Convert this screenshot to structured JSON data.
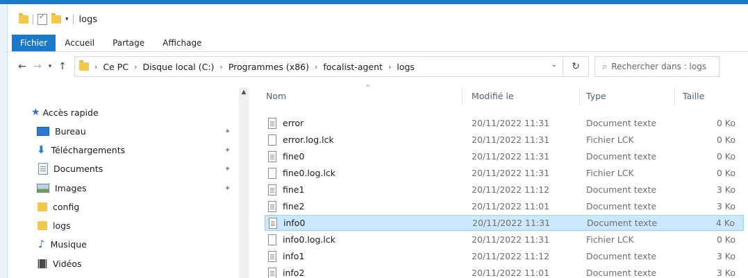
{
  "window": {
    "title": "logs"
  },
  "ribbon": {
    "tabs": [
      "Fichier",
      "Accueil",
      "Partage",
      "Affichage"
    ]
  },
  "address": {
    "crumbs": [
      "Ce PC",
      "Disque local (C:)",
      "Programmes (x86)",
      "focalist-agent",
      "logs"
    ]
  },
  "search": {
    "placeholder": "Rechercher dans : logs"
  },
  "nav": {
    "items": [
      {
        "label": "Accès rapide",
        "icon": "star-icon"
      },
      {
        "label": "Bureau",
        "icon": "desktop-icon",
        "pinned": true
      },
      {
        "label": "Téléchargements",
        "icon": "download-icon",
        "pinned": true
      },
      {
        "label": "Documents",
        "icon": "documents-icon",
        "pinned": true
      },
      {
        "label": "Images",
        "icon": "pictures-icon",
        "pinned": true
      },
      {
        "label": "config",
        "icon": "folder-icon"
      },
      {
        "label": "logs",
        "icon": "folder-icon"
      },
      {
        "label": "Musique",
        "icon": "music-icon"
      },
      {
        "label": "Vidéos",
        "icon": "videos-icon"
      }
    ]
  },
  "columns": {
    "name": "Nom",
    "modified": "Modifié le",
    "type": "Type",
    "size": "Taille"
  },
  "files": [
    {
      "name": "error",
      "modified": "20/11/2022 11:31",
      "type": "Document texte",
      "size": "0 Ko",
      "icon": "text-file-icon"
    },
    {
      "name": "error.log.lck",
      "modified": "20/11/2022 11:31",
      "type": "Fichier LCK",
      "size": "0 Ko",
      "icon": "file-icon"
    },
    {
      "name": "fine0",
      "modified": "20/11/2022 11:31",
      "type": "Document texte",
      "size": "0 Ko",
      "icon": "text-file-icon"
    },
    {
      "name": "fine0.log.lck",
      "modified": "20/11/2022 11:31",
      "type": "Fichier LCK",
      "size": "0 Ko",
      "icon": "file-icon"
    },
    {
      "name": "fine1",
      "modified": "20/11/2022 11:12",
      "type": "Document texte",
      "size": "3 Ko",
      "icon": "text-file-icon"
    },
    {
      "name": "fine2",
      "modified": "20/11/2022 11:01",
      "type": "Document texte",
      "size": "3 Ko",
      "icon": "text-file-icon"
    },
    {
      "name": "info0",
      "modified": "20/11/2022 11:31",
      "type": "Document texte",
      "size": "4 Ko",
      "icon": "text-file-icon",
      "selected": true
    },
    {
      "name": "info0.log.lck",
      "modified": "20/11/2022 11:31",
      "type": "Fichier LCK",
      "size": "0 Ko",
      "icon": "file-icon"
    },
    {
      "name": "info1",
      "modified": "20/11/2022 11:12",
      "type": "Document texte",
      "size": "3 Ko",
      "icon": "text-file-icon"
    },
    {
      "name": "info2",
      "modified": "20/11/2022 11:01",
      "type": "Document texte",
      "size": "3 Ko",
      "icon": "text-file-icon"
    }
  ],
  "colors": {
    "accent": "#1979ca",
    "selection": "#cce8ff",
    "folder": "#f2c94c"
  }
}
